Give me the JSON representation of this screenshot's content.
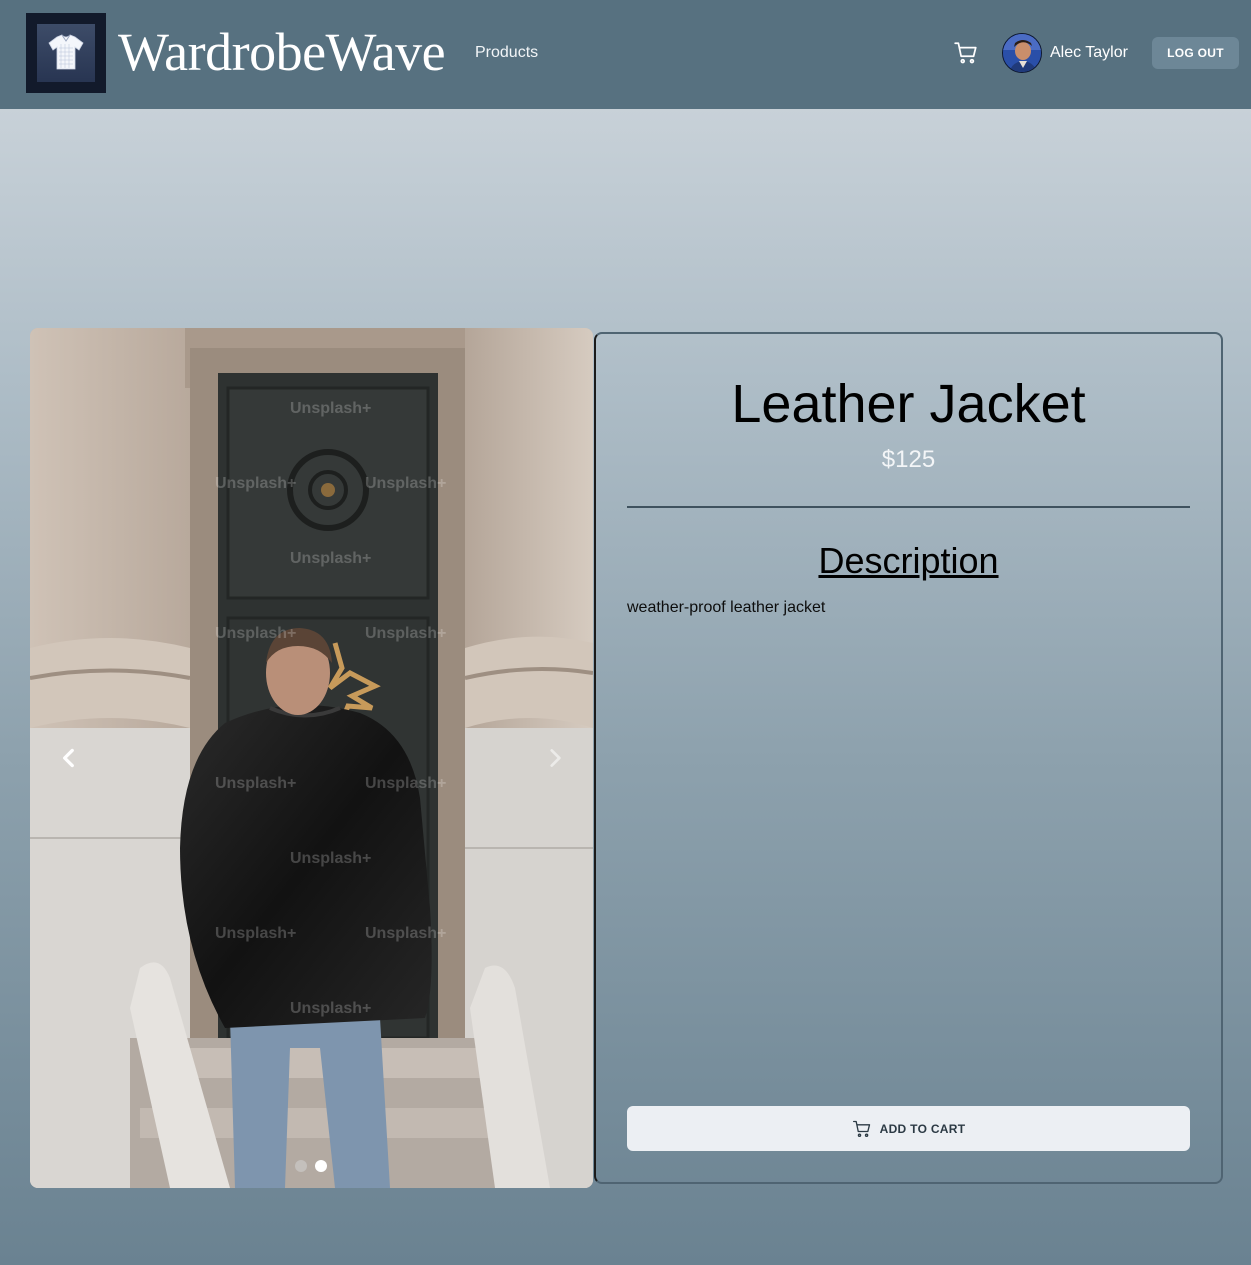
{
  "header": {
    "brand": "WardrobeWave",
    "nav": {
      "products_label": "Products"
    },
    "cart_icon": "shopping-cart-icon",
    "user": {
      "name": "Alec Taylor",
      "avatar": "user-avatar"
    },
    "logout_label": "LOG OUT"
  },
  "product": {
    "title": "Leather Jacket",
    "price": "$125",
    "description_heading": "Description",
    "description": "weather-proof leather jacket",
    "add_to_cart_label": "ADD TO CART",
    "add_to_cart_icon": "shopping-cart-icon"
  },
  "carousel": {
    "image": "man-in-black-leather-jacket-at-door",
    "watermark": "Unsplash+",
    "slide_count": 2,
    "active_slide": 2,
    "prev_icon": "chevron-left-icon",
    "next_icon": "chevron-right-icon"
  },
  "colors": {
    "header_bg": "#577180",
    "page_gradient_top": "#d2d9df",
    "page_gradient_bottom": "#6a8291",
    "logout_bg": "#6d8797",
    "add_to_cart_bg": "#eceff3"
  }
}
